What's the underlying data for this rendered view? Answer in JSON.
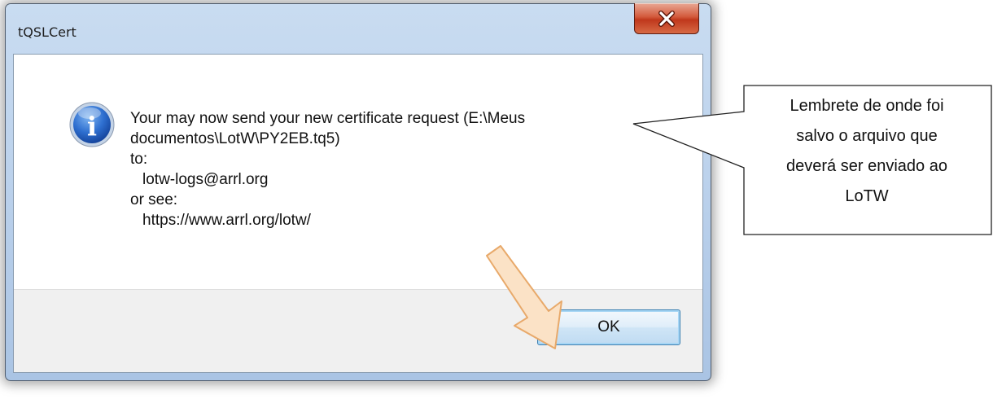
{
  "window": {
    "title": "tQSLCert",
    "close_icon": "close-x-icon"
  },
  "dialog": {
    "icon": "info-icon",
    "icon_letter": "i",
    "message_lines": [
      "Your may now send your new certificate request (E:\\Meus",
      "documentos\\LotW\\PY2EB.tq5)",
      "to:",
      "lotw-logs@arrl.org",
      "or see:",
      "https://www.arrl.org/lotw/"
    ],
    "ok_label": "OK"
  },
  "annotation": {
    "callout_lines": [
      "Lembrete de onde foi",
      "salvo o arquivo que",
      "deverá ser enviado ao",
      "LoTW"
    ],
    "arrow_icon": "pointer-arrow-icon"
  },
  "colors": {
    "frame": "#bcd2ec",
    "close_button": "#c7412a",
    "ok_border": "#3c7fb1",
    "arrow_fill": "#fbe2c6",
    "arrow_stroke": "#e8a96a"
  }
}
